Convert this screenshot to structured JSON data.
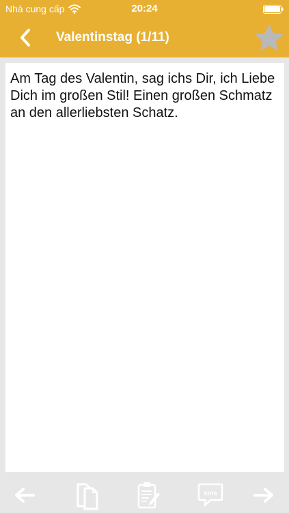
{
  "status_bar": {
    "carrier": "Nhà cung cấp",
    "time": "20:24"
  },
  "nav": {
    "title": "Valentinstag (1/11)",
    "favorite": false
  },
  "message": {
    "text": "Am Tag des Valentin, sag ichs Dir, ich Liebe Dich im großen Stil! Einen großen Schmatz an den allerliebsten Schatz."
  },
  "toolbar": {
    "sms_label": "sms"
  },
  "icons": {
    "back": "chevron-left-icon",
    "favorite": "star-icon",
    "previous": "arrow-left-icon",
    "copy": "copy-icon",
    "edit": "clipboard-edit-icon",
    "sms": "sms-bubble-icon",
    "next": "arrow-right-icon"
  },
  "colors": {
    "accent": "#e8b032",
    "toolbar_icon": "#ffffff",
    "star": "#b9b9b9",
    "background": "#e7e7e7"
  }
}
